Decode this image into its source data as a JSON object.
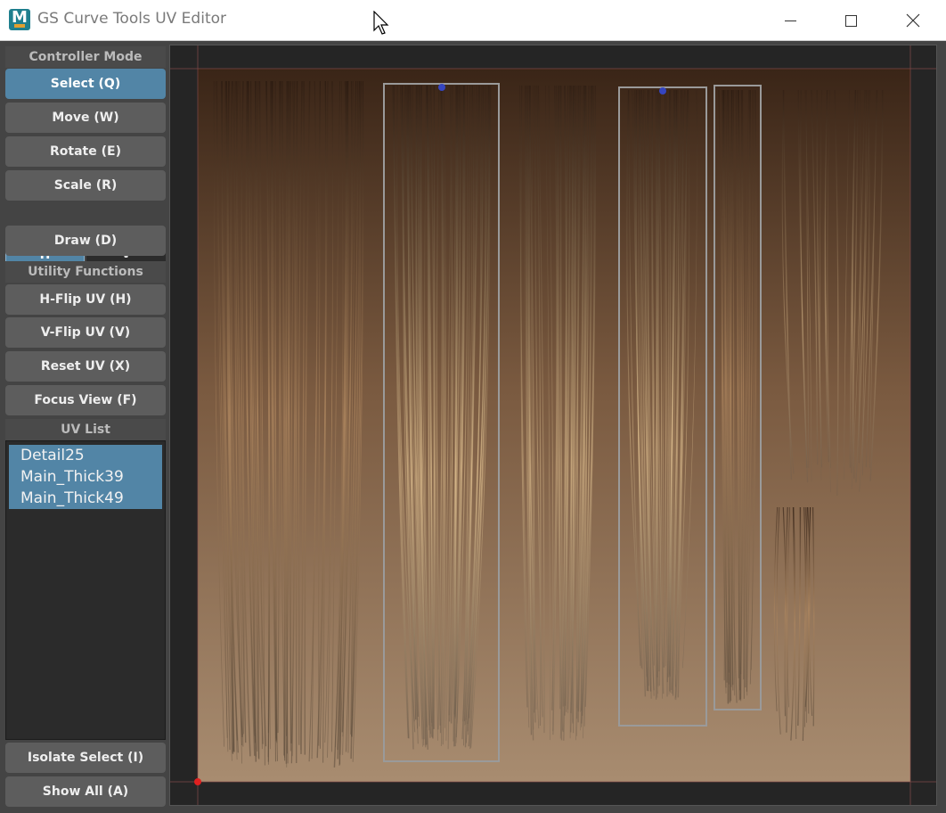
{
  "window": {
    "title": "GS Curve Tools UV Editor",
    "app_icon": "maya-m-icon",
    "controls": [
      "minimize-icon",
      "maximize-icon",
      "close-icon"
    ]
  },
  "sidebar": {
    "controller_mode_label": "Controller Mode",
    "buttons": {
      "select": "Select (Q)",
      "move": "Move (W)",
      "rotate": "Rotate (E)",
      "scale": "Scale (R)",
      "draw": "Draw (D)"
    },
    "scale_axis": {
      "h": "H",
      "v": "V",
      "selected": "H"
    },
    "utility_label": "Utility Functions",
    "utility": {
      "hflip": "H-Flip UV (H)",
      "vflip": "V-Flip UV (V)",
      "reset": "Reset UV (X)",
      "focus": "Focus View (F)"
    },
    "uv_list_label": "UV List",
    "uv_items": [
      "Detail25",
      "Main_Thick39",
      "Main_Thick49"
    ],
    "bottom": {
      "isolate": "Isolate Select (I)",
      "show_all": "Show All (A)"
    }
  },
  "viewport": {
    "selection_count": 3,
    "colors": {
      "background": "#252525",
      "texture_top": "#3a2517",
      "texture_mid": "#7a5a40",
      "texture_bottom": "#a88c70",
      "selection_outline": "#9a9a9a",
      "handle": "#3545c0",
      "origin": "#e02020",
      "accent": "#5285a6"
    }
  }
}
